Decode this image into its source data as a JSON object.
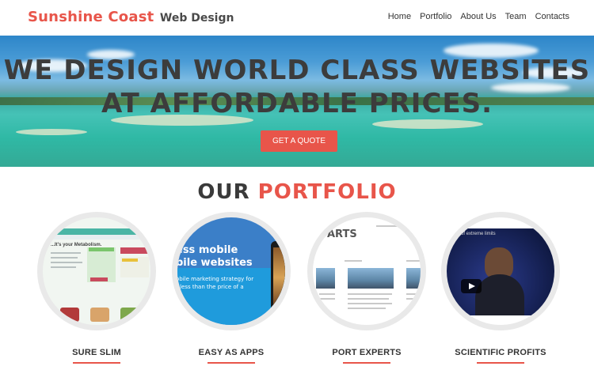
{
  "brand": {
    "main": "Sunshine Coast",
    "sub": "Web Design"
  },
  "nav": {
    "items": [
      "Home",
      "Portfolio",
      "About Us",
      "Team",
      "Contacts"
    ]
  },
  "hero": {
    "line1": "WE DESIGN WORLD CLASS WEBSITES",
    "line2": "AT AFFORDABLE PRICES.",
    "cta": "GET A QUOTE"
  },
  "portfolio": {
    "title_part1": "OUR",
    "title_part2": "PORTFOLIO",
    "items": [
      {
        "label": "SURE SLIM",
        "thumb_text": "...It's your Metabolism."
      },
      {
        "label": "EASY AS APPS",
        "thumb_text": [
          "ess mobile",
          "bile websites",
          "obile marketing strategy for",
          "r less than the price of a"
        ]
      },
      {
        "label": "PORT EXPERTS",
        "thumb_text": "ARTS"
      },
      {
        "label": "SCIENTIFIC PROFITS",
        "thumb_text": "of extreme limits"
      }
    ]
  },
  "colors": {
    "accent": "#e8554a",
    "dark_text": "#3a3a3a",
    "circle_border": "#e9e9e9"
  }
}
